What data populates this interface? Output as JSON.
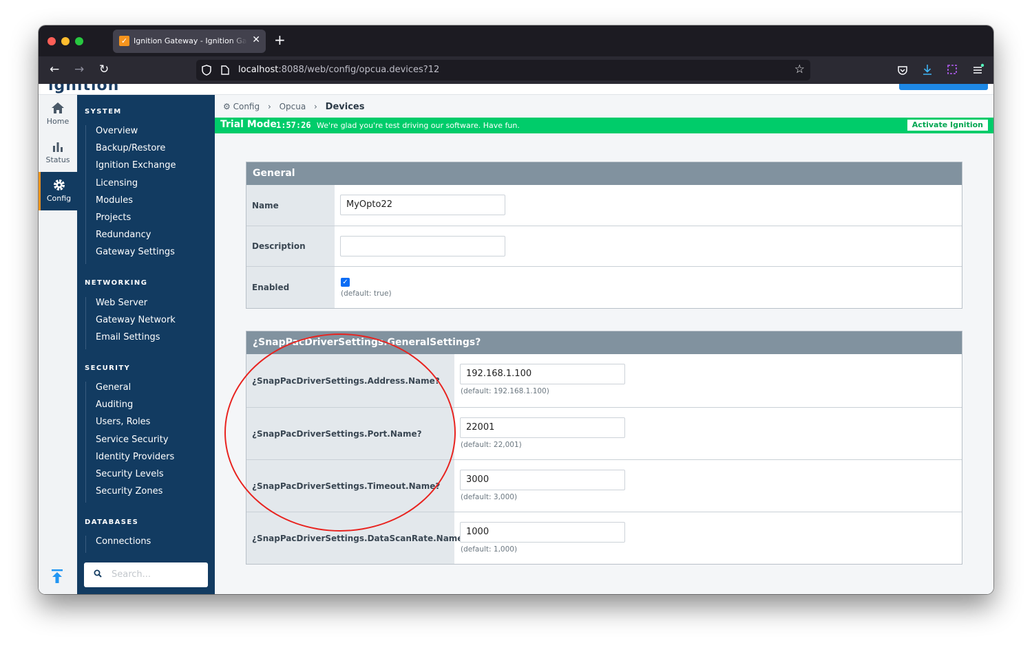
{
  "browser": {
    "tab_title": "Ignition Gateway - Ignition Gateway",
    "tab_favicon": "✓",
    "url_host": "localhost",
    "url_rest": ":8088/web/config/opcua.devices?12",
    "new_tab": "+",
    "close_tab": "✕"
  },
  "app": {
    "logo_text": "ignition",
    "icon_nav": [
      {
        "label": "Home",
        "icon": "home-icon"
      },
      {
        "label": "Status",
        "icon": "bar-chart-icon"
      },
      {
        "label": "Config",
        "icon": "gear-icon",
        "active": true
      }
    ]
  },
  "sidebar": {
    "sections": [
      {
        "title": "SYSTEM",
        "items": [
          "Overview",
          "Backup/Restore",
          "Ignition Exchange",
          "Licensing",
          "Modules",
          "Projects",
          "Redundancy",
          "Gateway Settings"
        ]
      },
      {
        "title": "NETWORKING",
        "items": [
          "Web Server",
          "Gateway Network",
          "Email Settings"
        ]
      },
      {
        "title": "SECURITY",
        "items": [
          "General",
          "Auditing",
          "Users, Roles",
          "Service Security",
          "Identity Providers",
          "Security Levels",
          "Security Zones"
        ]
      },
      {
        "title": "DATABASES",
        "items": [
          "Connections"
        ]
      }
    ],
    "search_placeholder": "Search..."
  },
  "breadcrumb": {
    "items": [
      "Config",
      "Opcua"
    ],
    "current": "Devices"
  },
  "trial": {
    "label": "Trial Mode",
    "timer": "1:57:26",
    "message": "We're glad you're test driving our software. Have fun.",
    "activate_label": "Activate Ignition"
  },
  "general": {
    "title": "General",
    "name_label": "Name",
    "name_value": "MyOpto22",
    "description_label": "Description",
    "description_value": "",
    "enabled_label": "Enabled",
    "enabled_checked": true,
    "enabled_hint": "(default: true)"
  },
  "driver": {
    "title": "¿SnapPacDriverSettings.GeneralSettings?",
    "rows": [
      {
        "label": "¿SnapPacDriverSettings.Address.Name?",
        "value": "192.168.1.100",
        "hint": "(default: 192.168.1.100)"
      },
      {
        "label": "¿SnapPacDriverSettings.Port.Name?",
        "value": "22001",
        "hint": "(default: 22,001)"
      },
      {
        "label": "¿SnapPacDriverSettings.Timeout.Name?",
        "value": "3000",
        "hint": "(default: 3,000)"
      },
      {
        "label": "¿SnapPacDriverSettings.DataScanRate.Name?",
        "value": "1000",
        "hint": "(default: 1,000)"
      }
    ]
  },
  "colors": {
    "sidebar_bg": "#123b61",
    "trial_green": "#00cc6a",
    "panel_header": "#81929f",
    "annotation_circle": "#e8231f"
  }
}
